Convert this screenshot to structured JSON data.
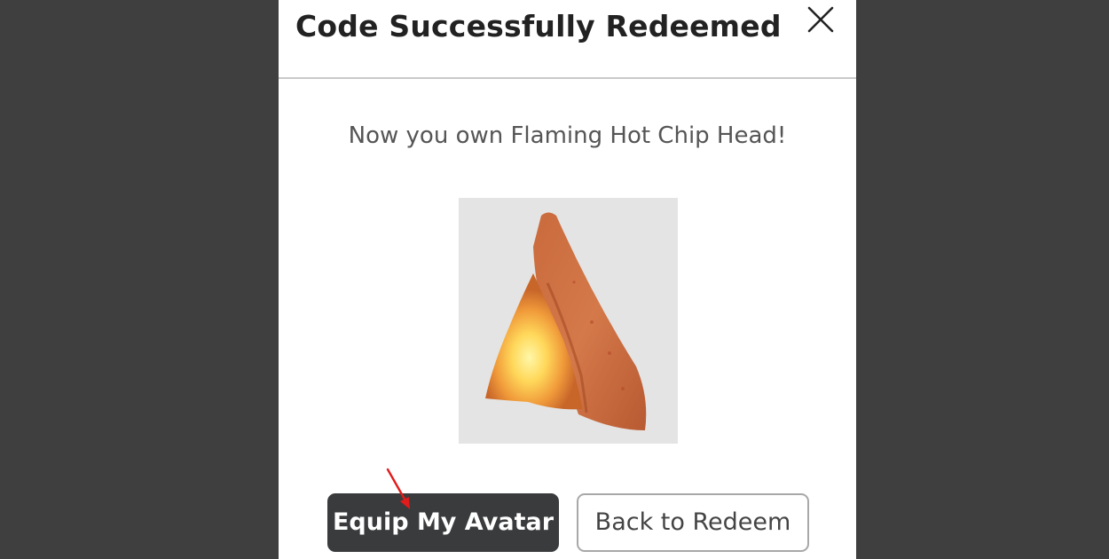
{
  "modal": {
    "title": "Code Successfully Redeemed",
    "close_icon": "close-icon",
    "message": "Now you own Flaming Hot Chip Head!",
    "item_image": "flaming-hot-chip-head-image"
  },
  "buttons": {
    "primary_label": "Equip My Avatar",
    "secondary_label": "Back to Redeem"
  },
  "annotation": {
    "icon": "red-arrow-icon",
    "color": "#e21b1b"
  },
  "colors": {
    "backdrop": "#3f3f3f",
    "primary_button": "#393b3d",
    "thumbnail_bg": "#e4e4e4"
  }
}
